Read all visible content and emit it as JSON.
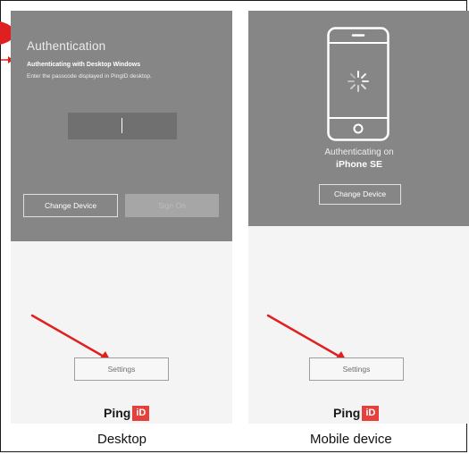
{
  "desktop": {
    "title": "Authentication",
    "subtitle": "Authenticating with Desktop Windows",
    "instruction": "Enter the passcode displayed in PingID desktop.",
    "change_device_label": "Change Device",
    "sign_on_label": "Sign On",
    "settings_label": "Settings",
    "caption": "Desktop"
  },
  "mobile": {
    "authenticating_on": "Authenticating on",
    "device_name": "iPhone SE",
    "change_device_label": "Change Device",
    "settings_label": "Settings",
    "caption": "Mobile device"
  },
  "logo": {
    "text": "Ping",
    "badge": "iD"
  },
  "colors": {
    "panel_dark": "#868686",
    "panel_light": "#f4f4f4",
    "annotation_red": "#e02020",
    "logo_red": "#e5403b"
  }
}
